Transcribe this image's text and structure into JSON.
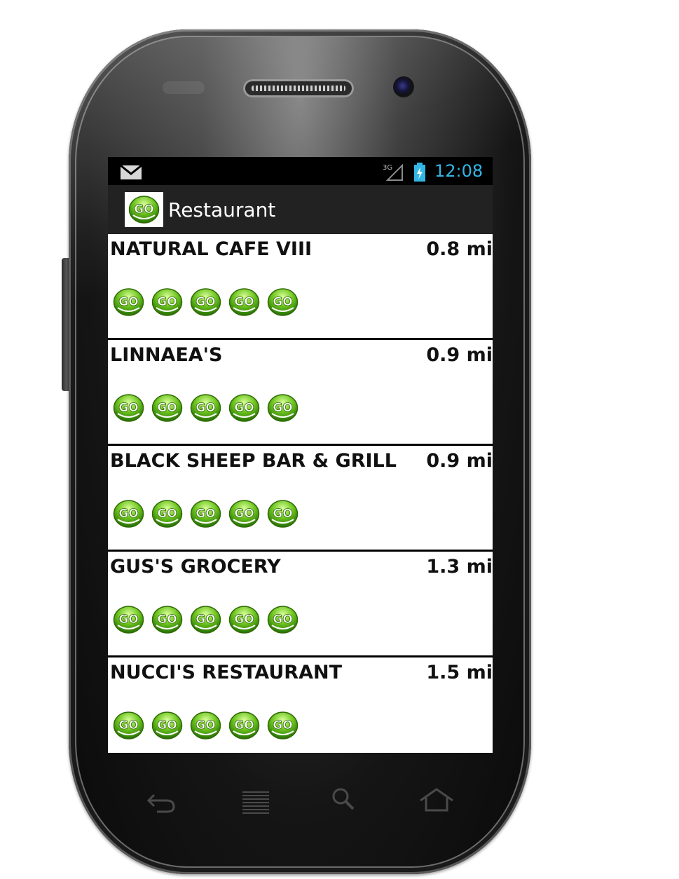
{
  "status_bar": {
    "time": "12:08",
    "network": "3G",
    "icons": [
      "mail-icon",
      "signal-icon",
      "battery-icon"
    ]
  },
  "action_bar": {
    "title": "Restaurant",
    "icon": "go-logo-icon"
  },
  "restaurants": [
    {
      "name": "NATURAL CAFE VIII",
      "distance": "0.8 mi",
      "rating": 5
    },
    {
      "name": "LINNAEA'S",
      "distance": "0.9 mi",
      "rating": 5
    },
    {
      "name": "BLACK SHEEP BAR & GRILL",
      "distance": "0.9 mi",
      "rating": 5
    },
    {
      "name": "GUS'S GROCERY",
      "distance": "1.3 mi",
      "rating": 5
    },
    {
      "name": "NUCCI'S RESTAURANT",
      "distance": "1.5 mi",
      "rating": 5
    }
  ],
  "rating_icon_text": "GO",
  "nav_keys": [
    "back-icon",
    "menu-icon",
    "search-icon",
    "home-icon"
  ],
  "colors": {
    "clock": "#33b5e5",
    "action_bar": "#222222",
    "go_green": "#6cc41e"
  }
}
